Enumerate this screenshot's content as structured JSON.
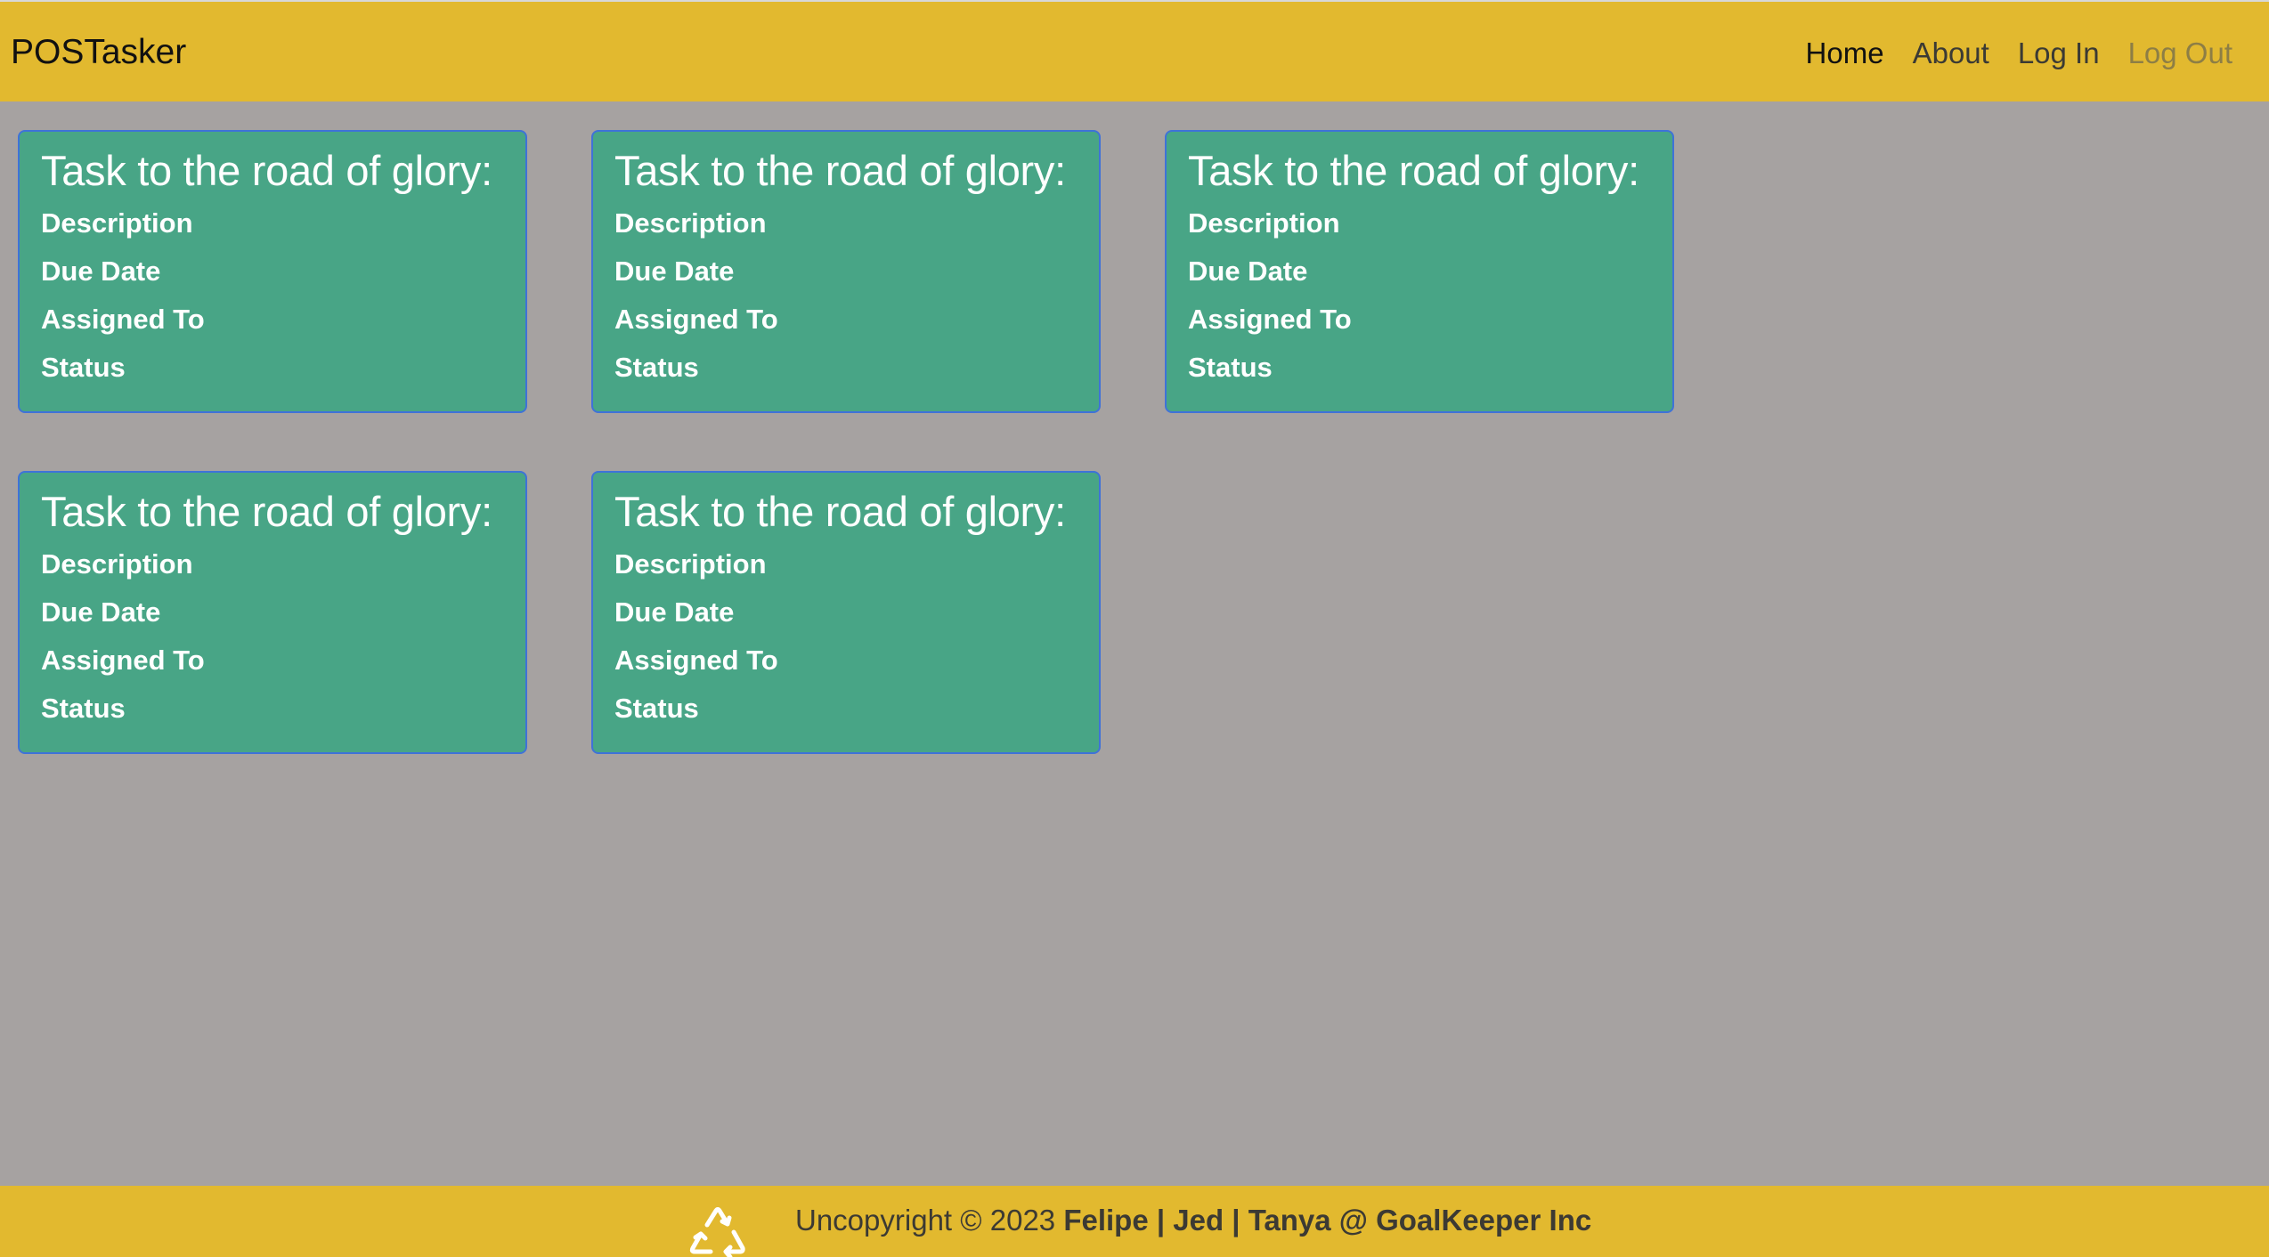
{
  "navbar": {
    "brand": "POSTasker",
    "links": [
      {
        "label": "Home"
      },
      {
        "label": "About"
      },
      {
        "label": "Log In"
      },
      {
        "label": "Log Out"
      }
    ]
  },
  "tasks": [
    {
      "title": "Task to the road of glory:",
      "description": "Description",
      "due_date": "Due Date",
      "assigned_to": "Assigned To",
      "status": "Status"
    },
    {
      "title": "Task to the road of glory:",
      "description": "Description",
      "due_date": "Due Date",
      "assigned_to": "Assigned To",
      "status": "Status"
    },
    {
      "title": "Task to the road of glory:",
      "description": "Description",
      "due_date": "Due Date",
      "assigned_to": "Assigned To",
      "status": "Status"
    },
    {
      "title": "Task to the road of glory:",
      "description": "Description",
      "due_date": "Due Date",
      "assigned_to": "Assigned To",
      "status": "Status"
    },
    {
      "title": "Task to the road of glory:",
      "description": "Description",
      "due_date": "Due Date",
      "assigned_to": "Assigned To",
      "status": "Status"
    }
  ],
  "footer": {
    "copyright_prefix": "Uncopyright © 2023",
    "authors": "Felipe | Jed | Tanya @ GoalKeeper Inc",
    "icon": "recycle-icon"
  },
  "colors": {
    "navbar_bg": "#e2b92f",
    "page_bg": "#a6a2a1",
    "card_bg": "#48a586",
    "card_border": "#3f72d8"
  }
}
